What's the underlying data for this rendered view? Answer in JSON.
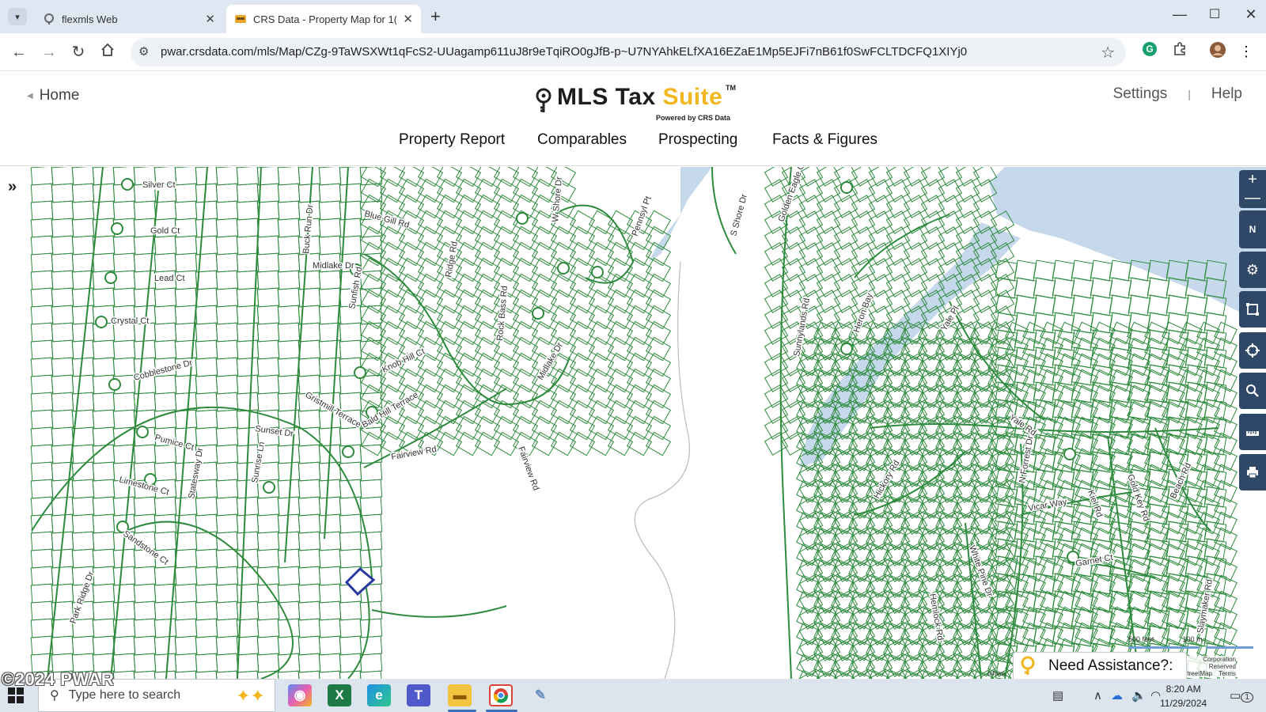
{
  "browser": {
    "tabs": [
      {
        "label": "flexmls Web",
        "favicon": "flexmls-favicon-icon",
        "active": false
      },
      {
        "label": "CRS Data - Property Map for 1(",
        "favicon": "crs-favicon-icon",
        "active": true
      }
    ],
    "url": "pwar.crsdata.com/mls/Map/CZg-9TaWSXWt1qFcS2-UUagamp611uJ8r9eTqiRO0gJfB-p~U7NYAhkELfXA16EZaE1Mp5EJFi7nB61f0SwFCLTDCFQ1XIYj0"
  },
  "app": {
    "home_label": "Home",
    "logo": {
      "mls": "MLS Tax ",
      "suite": "Suite",
      "tm": "TM",
      "powered": "Powered by CRS Data"
    },
    "settings_label": "Settings",
    "separator": "|",
    "help_label": "Help",
    "nav": [
      "Property Report",
      "Comparables",
      "Prospecting",
      "Facts & Figures"
    ]
  },
  "map": {
    "street_labels": [
      "Silver Ct",
      "Gold Ct",
      "Lead Ct",
      "Crystal Ct",
      "Cobblestone Dr",
      "Pumice Ct",
      "Limestone Ct",
      "Sandstone Ct",
      "Park Ridge Dr",
      "Blue Gill Rd",
      "Midlake Dr",
      "Sunfish Rd",
      "Knob Hill Ct",
      "Gristmill Terrace",
      "Bald Hill Terrace",
      "Sunset Dr",
      "Fairview Rd",
      "Ridge Rd",
      "Rock Bass Rd",
      "Pennsyl Pt",
      "W Shore Dr",
      "S Shore Dr",
      "Golden Eagle Ct",
      "Sunnylands Rd",
      "Heron Bay",
      "Yale Pl",
      "Yale Rd",
      "Hickory Rd",
      "N Forrest Dr",
      "Vicar Way",
      "Kiel Rd",
      "Gold Key Rd",
      "Beach Rd",
      "Garnet Ct",
      "White Pine Dr",
      "Hemlock Rd",
      "Slaymaker Rd",
      "Sunrise Ln",
      "Buck Run Dr",
      "Statesway Dr",
      "Fairview Rd",
      "Midlake Dr"
    ],
    "scale_feet": "500 feet",
    "scale_meters": "100 m",
    "assist_label": "Need Assistance?:",
    "attribution": "Corporation\nReserved\nStreetMap",
    "terms": "Terms",
    "inform": "Inform"
  },
  "watermark": "©2024 PWAR",
  "taskbar": {
    "search_placeholder": "Type here to search",
    "time": "8:20 AM",
    "date": "11/29/2024",
    "notification_count": "1"
  },
  "colors": {
    "parcel_line": "#2e8b3d",
    "water": "#c6d8ec",
    "map_ctl": "#2f4868",
    "brand_yellow": "#f2b61e",
    "selected_parcel": "#2a3aa0"
  }
}
